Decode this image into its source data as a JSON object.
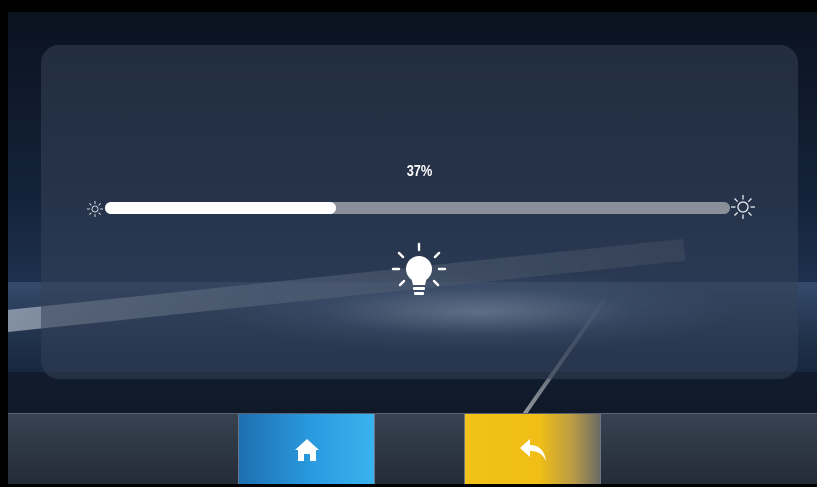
{
  "brightness": {
    "label": "37%",
    "level_fraction": 0.37
  },
  "icons": {
    "min": "sun-small-icon",
    "max": "sun-large-icon",
    "light": "lightbulb-icon",
    "home": "home-icon",
    "back": "back-arrow-icon"
  },
  "colors": {
    "home_button": "#2a9be0",
    "back_button": "#f2c21a",
    "slider_fill": "#ffffff",
    "slider_track": "#8a9099"
  }
}
